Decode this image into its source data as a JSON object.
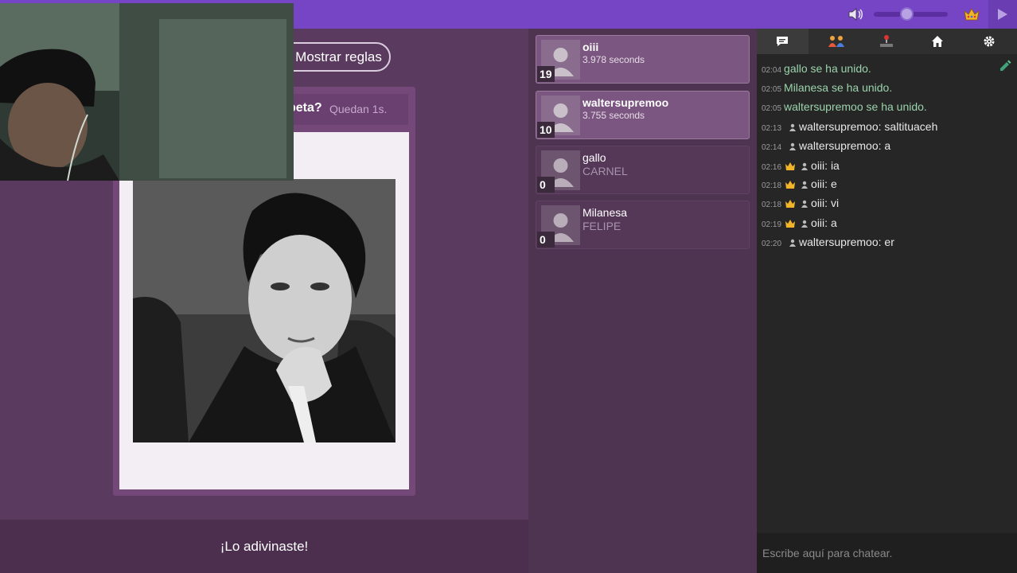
{
  "game": {
    "rules_button": "Mostrar reglas",
    "question": "peta?",
    "timer": "Quedan 1s.",
    "guessed_text": "¡Lo adivinaste!"
  },
  "players": [
    {
      "name": "oiii",
      "info": "3.978 seconds",
      "score": "19"
    },
    {
      "name": "waltersupremoo",
      "info": "3.755 seconds",
      "score": "10"
    },
    {
      "name": "gallo",
      "info": "CARNEL",
      "score": "0"
    },
    {
      "name": "Milanesa",
      "info": "FELIPE",
      "score": "0"
    }
  ],
  "chat": {
    "messages": [
      {
        "time": "02:04",
        "text": "gallo se ha unido."
      },
      {
        "time": "02:05",
        "text": "Milanesa se ha unido."
      },
      {
        "time": "02:05",
        "text": "waltersupremoo se ha unido."
      },
      {
        "time": "02:13",
        "user": "waltersupremoo",
        "msg": "saltituaceh"
      },
      {
        "time": "02:14",
        "user": "waltersupremoo",
        "msg": "a"
      },
      {
        "time": "02:16",
        "user": "oiii",
        "msg": "ia"
      },
      {
        "time": "02:18",
        "user": "oiii",
        "msg": "e"
      },
      {
        "time": "02:18",
        "user": "oiii",
        "msg": "vi"
      },
      {
        "time": "02:19",
        "user": "oiii",
        "msg": "a"
      },
      {
        "time": "02:20",
        "user": "waltersupremoo",
        "msg": "er"
      }
    ],
    "input_placeholder": "Escribe aquí para chatear."
  },
  "icons": {
    "volume": "speaker-icon",
    "crown": "crown-icon",
    "play": "play-icon",
    "tabs": [
      "chat-icon",
      "users-icon",
      "joystick-icon",
      "home-icon",
      "gear-icon"
    ]
  },
  "colors": {
    "topbar": "#7645c5",
    "system_message": "#9bd3ac",
    "card": "#75487a"
  }
}
